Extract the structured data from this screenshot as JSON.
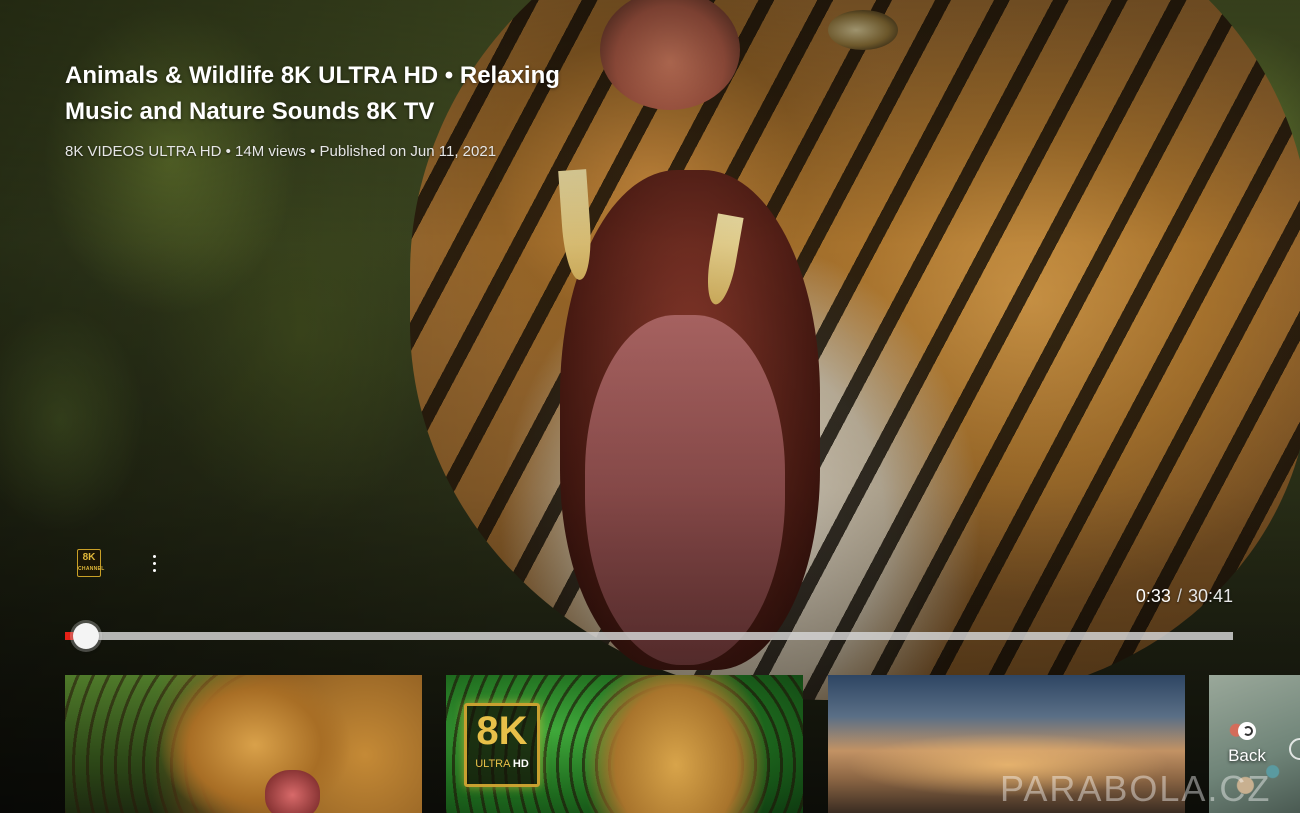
{
  "video": {
    "title": "Animals & Wildlife 8K ULTRA HD • Relaxing Music and Nature Sounds 8K TV",
    "channel": "8K VIDEOS ULTRA HD",
    "views": "14M views",
    "published": "Published on Jun 11, 2021",
    "separator": "•"
  },
  "channel_badge": {
    "icon": "8k-channel-icon",
    "text": "8K",
    "subtext": "CHANNEL"
  },
  "playback": {
    "current_time": "0:33",
    "time_separator": "/",
    "duration": "30:41",
    "progress_fraction": 0.018,
    "played_color": "#e62117"
  },
  "thumbnails": [
    {
      "id": "thumb-1",
      "subject": "leopard-roaring"
    },
    {
      "id": "thumb-2",
      "subject": "jaguar-8k-logo",
      "logo_big": "8K",
      "logo_small": "ULTRA",
      "logo_small_bold": "HD"
    },
    {
      "id": "thumb-3",
      "subject": "sunset-landscape"
    },
    {
      "id": "thumb-4",
      "subject": "coastal-town"
    }
  ],
  "back_button": {
    "label": "Back",
    "icon": "back-circle-icon"
  },
  "more_options": {
    "icon": "more-vertical-icon"
  },
  "watermark": "PARABOLA.CZ"
}
